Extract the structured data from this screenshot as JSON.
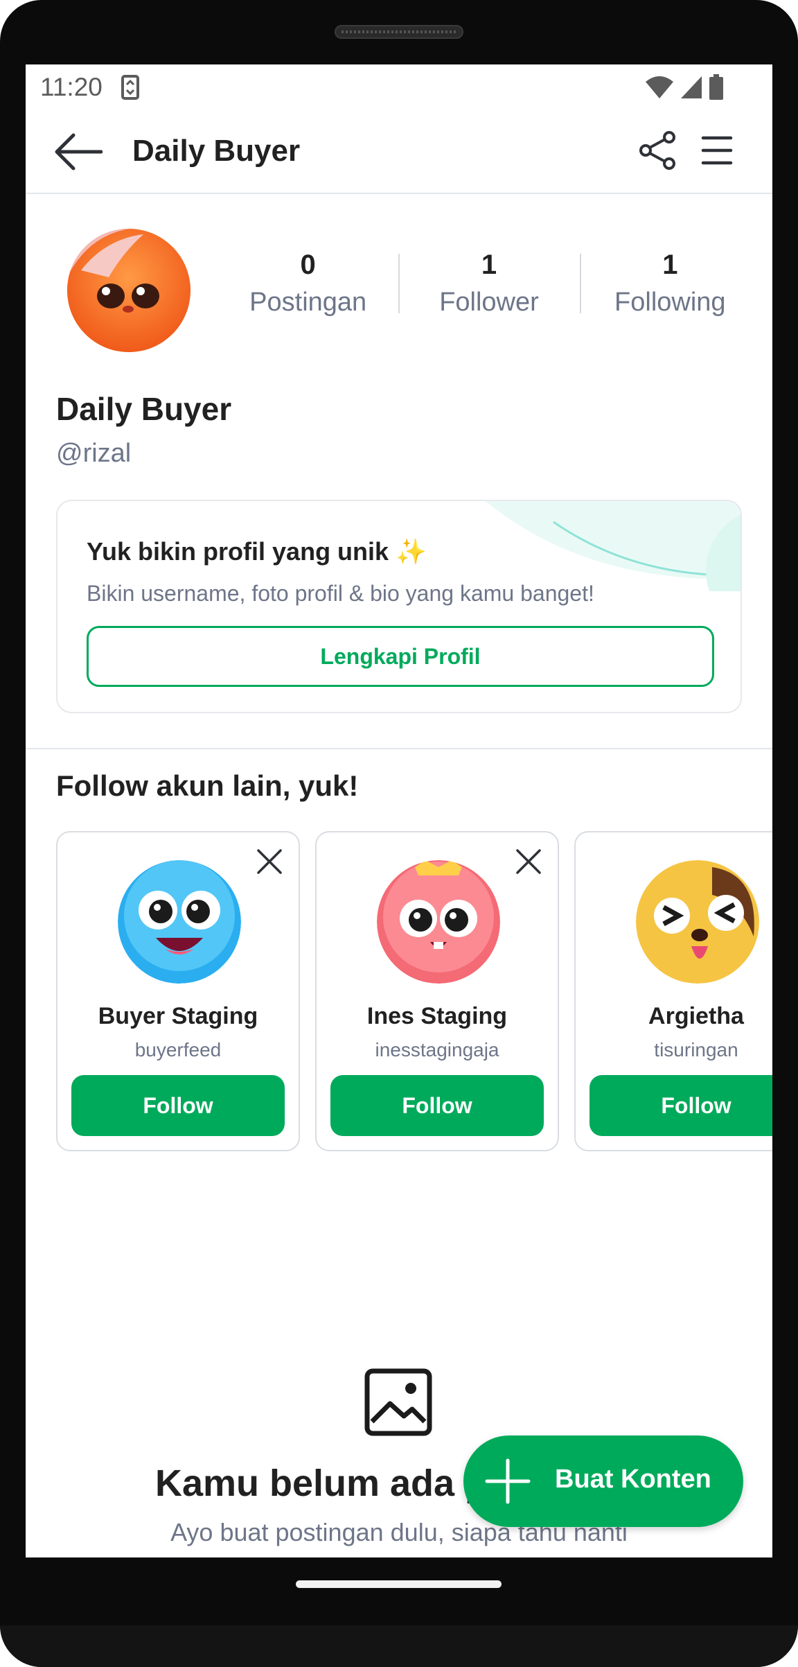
{
  "status_bar": {
    "time": "11:20"
  },
  "app_bar": {
    "title": "Daily Buyer"
  },
  "profile": {
    "stats": [
      {
        "value": "0",
        "label": "Postingan"
      },
      {
        "value": "1",
        "label": "Follower"
      },
      {
        "value": "1",
        "label": "Following"
      }
    ],
    "name": "Daily Buyer",
    "handle": "@rizal"
  },
  "onboarding_card": {
    "title": "Yuk bikin profil yang unik ✨",
    "subtitle": "Bikin username, foto profil & bio yang kamu banget!",
    "button_label": "Lengkapi Profil"
  },
  "suggestions": {
    "title": "Follow akun lain, yuk!",
    "accounts": [
      {
        "name": "Buyer Staging",
        "username": "buyerfeed",
        "button": "Follow"
      },
      {
        "name": "Ines Staging",
        "username": "inesstagingaja",
        "button": "Follow"
      },
      {
        "name": "Argietha",
        "username": "tisuringan",
        "button": "Follow"
      }
    ]
  },
  "empty_state": {
    "title": "Kamu belum ada postingan",
    "subtitle": "Ayo buat postingan dulu, siapa tahu nanti"
  },
  "fab": {
    "label": "Buat Konten"
  },
  "colors": {
    "primary": "#00aa5b",
    "text": "#212121",
    "muted": "#6d7588"
  }
}
